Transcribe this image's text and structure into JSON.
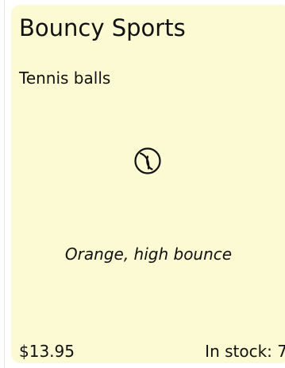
{
  "card": {
    "brand": "Bouncy Sports",
    "product": "Tennis balls",
    "icon": "tennis-ball-icon",
    "description": "Orange, high bounce",
    "price": "$13.95",
    "stock": "In stock: 7",
    "background": "#fbfad3"
  }
}
